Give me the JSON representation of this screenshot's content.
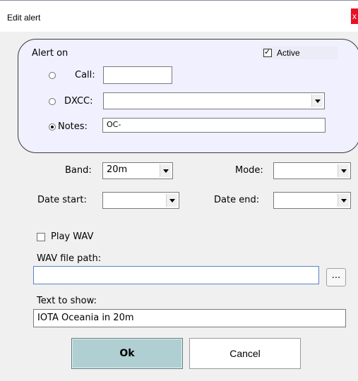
{
  "window": {
    "title": "Edit alert",
    "close_label": "x"
  },
  "alert_on": {
    "heading": "Alert on",
    "active": {
      "label": "Active",
      "checked": true
    },
    "call": {
      "label": "Call:",
      "value": "",
      "selected": false
    },
    "dxcc": {
      "label": "DXCC:",
      "value": "",
      "selected": false
    },
    "notes": {
      "label": "Notes:",
      "value": "OC-",
      "selected": true
    }
  },
  "band": {
    "label": "Band:",
    "value": "20m"
  },
  "mode": {
    "label": "Mode:",
    "value": ""
  },
  "date_start": {
    "label": "Date start:",
    "value": ""
  },
  "date_end": {
    "label": "Date end:",
    "value": ""
  },
  "play_wav": {
    "label": "Play WAV",
    "checked": false
  },
  "wav_path": {
    "label": "WAV file path:",
    "value": "",
    "browse_label": "..."
  },
  "text_to_show": {
    "label": "Text to show:",
    "value": "IOTA Oceania in 20m"
  },
  "buttons": {
    "ok": "Ok",
    "cancel": "Cancel"
  }
}
